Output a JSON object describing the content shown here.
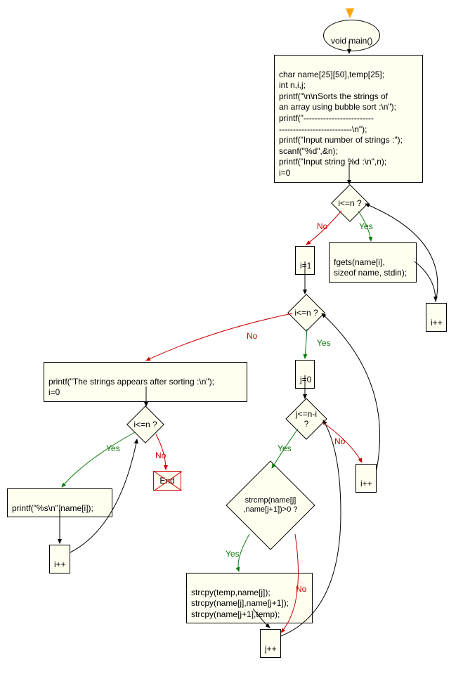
{
  "chart_data": {
    "type": "flowchart",
    "nodes": [
      {
        "id": "start",
        "kind": "terminal",
        "label": "void main()"
      },
      {
        "id": "init",
        "kind": "process",
        "label": "char name[25][50],temp[25];\nint n,i,j;\nprintf(\"\\n\\nSorts the strings of\nan array using bubble sort :\\n\");\nprintf(\"-------------------------\n--------------------------\\n\");\nprintf(\"Input number of strings :\");\nscanf(\"%d\",&n);\nprintf(\"Input string %d :\\n\",n);\ni=0"
      },
      {
        "id": "cond1",
        "kind": "decision",
        "label": "i<=n ?"
      },
      {
        "id": "fgets",
        "kind": "process",
        "label": "fgets(name[i],\nsizeof name, stdin);"
      },
      {
        "id": "ipp1",
        "kind": "process",
        "label": "i++"
      },
      {
        "id": "iset1",
        "kind": "process",
        "label": "i=1"
      },
      {
        "id": "cond2",
        "kind": "decision",
        "label": "i<=n ?"
      },
      {
        "id": "jset0",
        "kind": "process",
        "label": "j=0"
      },
      {
        "id": "cond3",
        "kind": "decision",
        "label": "j<=n-i ?"
      },
      {
        "id": "cond4",
        "kind": "decision",
        "label": "strcmp(name[j]\n,name[j+1])>0 ?"
      },
      {
        "id": "swap",
        "kind": "process",
        "label": "strcpy(temp,name[j]);\nstrcpy(name[j],name[j+1]);\nstrcpy(name[j+1],temp);"
      },
      {
        "id": "jpp",
        "kind": "process",
        "label": "j++"
      },
      {
        "id": "ipp2",
        "kind": "process",
        "label": "i++"
      },
      {
        "id": "printhdr",
        "kind": "process",
        "label": "printf(\"The strings appears after sorting :\\n\");\ni=0"
      },
      {
        "id": "cond5",
        "kind": "decision",
        "label": "i<=n ?"
      },
      {
        "id": "prints",
        "kind": "process",
        "label": "printf(\"%s\\n\",name[i]);"
      },
      {
        "id": "ipp3",
        "kind": "process",
        "label": "i++"
      },
      {
        "id": "end",
        "kind": "terminal",
        "label": "End"
      }
    ],
    "edges": [
      {
        "from": "start",
        "to": "init"
      },
      {
        "from": "init",
        "to": "cond1"
      },
      {
        "from": "cond1",
        "to": "fgets",
        "label": "Yes"
      },
      {
        "from": "fgets",
        "to": "ipp1"
      },
      {
        "from": "ipp1",
        "to": "cond1"
      },
      {
        "from": "cond1",
        "to": "iset1",
        "label": "No"
      },
      {
        "from": "iset1",
        "to": "cond2"
      },
      {
        "from": "cond2",
        "to": "jset0",
        "label": "Yes"
      },
      {
        "from": "jset0",
        "to": "cond3"
      },
      {
        "from": "cond3",
        "to": "cond4",
        "label": "Yes"
      },
      {
        "from": "cond4",
        "to": "swap",
        "label": "Yes"
      },
      {
        "from": "swap",
        "to": "jpp"
      },
      {
        "from": "cond4",
        "to": "jpp",
        "label": "No"
      },
      {
        "from": "jpp",
        "to": "cond3"
      },
      {
        "from": "cond3",
        "to": "ipp2",
        "label": "No"
      },
      {
        "from": "ipp2",
        "to": "cond2"
      },
      {
        "from": "cond2",
        "to": "printhdr",
        "label": "No"
      },
      {
        "from": "printhdr",
        "to": "cond5"
      },
      {
        "from": "cond5",
        "to": "prints",
        "label": "Yes"
      },
      {
        "from": "prints",
        "to": "ipp3"
      },
      {
        "from": "ipp3",
        "to": "cond5"
      },
      {
        "from": "cond5",
        "to": "end",
        "label": "No"
      }
    ]
  }
}
